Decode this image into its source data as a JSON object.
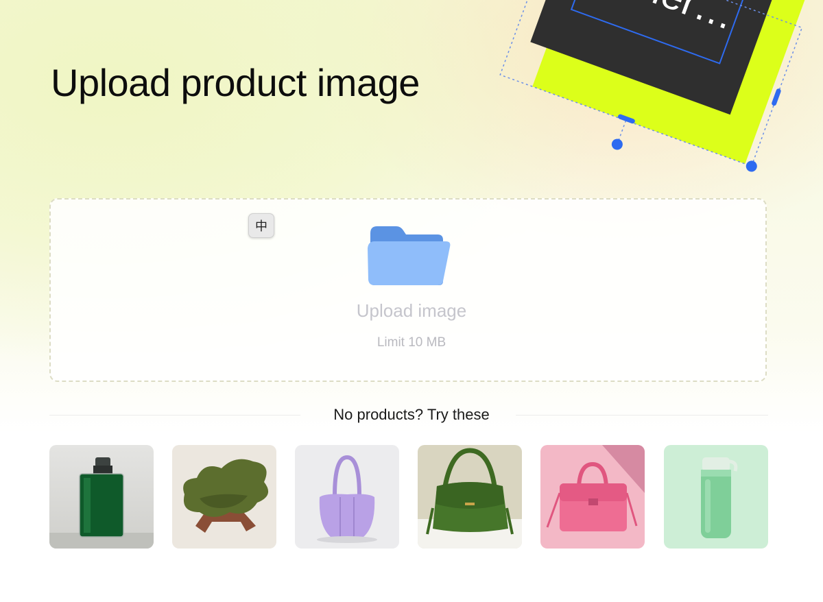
{
  "header": {
    "title": "Upload product image"
  },
  "decoration": {
    "text": "gener…",
    "accent_color": "#dcff1a",
    "card_color": "#2f2f2f",
    "handle_color": "#2e6bf0"
  },
  "upload": {
    "ime_indicator": "中",
    "icon": "folder-icon",
    "label": "Upload image",
    "limit": "Limit 10 MB"
  },
  "samples": {
    "heading": "No products? Try these",
    "items": [
      {
        "name": "green-perfume-bottle",
        "bg": "#dcdcd8"
      },
      {
        "name": "green-velvet-chair",
        "bg": "#ece7df"
      },
      {
        "name": "lilac-shoulder-bag",
        "bg": "#ececee"
      },
      {
        "name": "green-leather-handbag",
        "bg": "#d9d5c0"
      },
      {
        "name": "pink-crossbody-bag",
        "bg": "#f3b8c6"
      },
      {
        "name": "mint-water-bottle",
        "bg": "#cdeed6"
      }
    ]
  }
}
